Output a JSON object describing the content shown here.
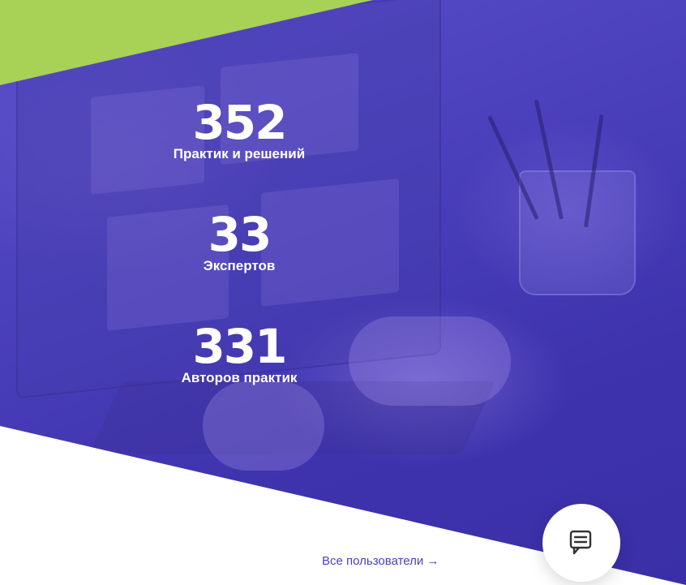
{
  "stats": [
    {
      "value": "352",
      "label": "Практик и решений"
    },
    {
      "value": "33",
      "label": "Экспертов"
    },
    {
      "value": "331",
      "label": "Авторов практик"
    }
  ],
  "footer": {
    "all_users_link": "Все пользователи →"
  },
  "colors": {
    "accent_green": "#a8d256",
    "hero_purple": "#4a3fbb",
    "link_purple": "#4a3fc4"
  },
  "icons": {
    "chat_button": "chat-icon"
  }
}
